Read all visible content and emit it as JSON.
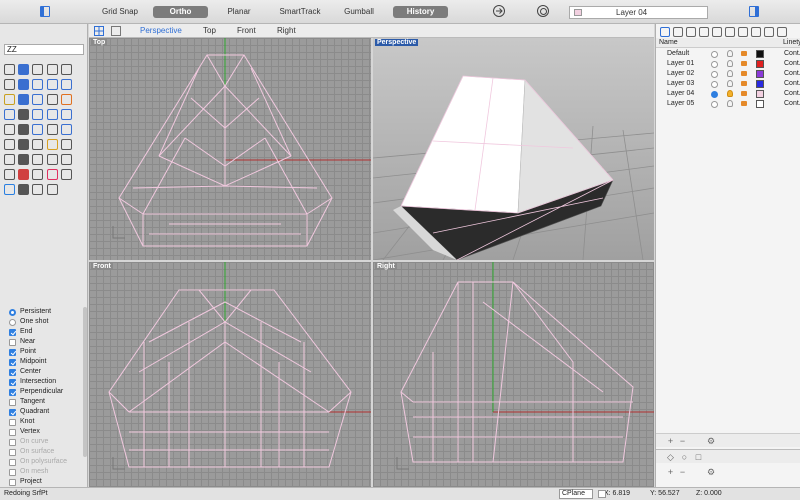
{
  "toolbar": {
    "grid_snap": "Grid Snap",
    "ortho": "Ortho",
    "planar": "Planar",
    "smarttrack": "SmartTrack",
    "gumball": "Gumball",
    "history": "History",
    "layer_current": "Layer 04"
  },
  "command_input": "ZZ",
  "viewport_tabs": [
    "Perspective",
    "Top",
    "Front",
    "Right"
  ],
  "viewports": {
    "top": "Top",
    "perspective": "Perspective",
    "front": "Front",
    "right": "Right"
  },
  "osnap": {
    "items": [
      {
        "label": "Persistent",
        "type": "radio",
        "checked": true,
        "disabled": false
      },
      {
        "label": "One shot",
        "type": "radio",
        "checked": false,
        "disabled": false
      },
      {
        "label": "End",
        "type": "check",
        "checked": true,
        "disabled": false
      },
      {
        "label": "Near",
        "type": "check",
        "checked": false,
        "disabled": false
      },
      {
        "label": "Point",
        "type": "check",
        "checked": true,
        "disabled": false
      },
      {
        "label": "Midpoint",
        "type": "check",
        "checked": true,
        "disabled": false
      },
      {
        "label": "Center",
        "type": "check",
        "checked": true,
        "disabled": false
      },
      {
        "label": "Intersection",
        "type": "check",
        "checked": true,
        "disabled": false
      },
      {
        "label": "Perpendicular",
        "type": "check",
        "checked": true,
        "disabled": false
      },
      {
        "label": "Tangent",
        "type": "check",
        "checked": false,
        "disabled": false
      },
      {
        "label": "Quadrant",
        "type": "check",
        "checked": true,
        "disabled": false
      },
      {
        "label": "Knot",
        "type": "check",
        "checked": false,
        "disabled": false
      },
      {
        "label": "Vertex",
        "type": "check",
        "checked": false,
        "disabled": false
      },
      {
        "label": "On curve",
        "type": "check",
        "checked": false,
        "disabled": true
      },
      {
        "label": "On surface",
        "type": "check",
        "checked": false,
        "disabled": true
      },
      {
        "label": "On polysurface",
        "type": "check",
        "checked": false,
        "disabled": true
      },
      {
        "label": "On mesh",
        "type": "check",
        "checked": false,
        "disabled": true
      },
      {
        "label": "Project",
        "type": "check",
        "checked": false,
        "disabled": false
      }
    ]
  },
  "layers": {
    "header_name": "Name",
    "header_linetype": "Linety",
    "rows": [
      {
        "name": "Default",
        "current": false,
        "lit": false,
        "color": "#111111",
        "linetype": "Cont."
      },
      {
        "name": "Layer 01",
        "current": false,
        "lit": false,
        "color": "#e02020",
        "linetype": "Cont."
      },
      {
        "name": "Layer 02",
        "current": false,
        "lit": false,
        "color": "#8a3ad8",
        "linetype": "Cont."
      },
      {
        "name": "Layer 03",
        "current": false,
        "lit": false,
        "color": "#2a2ae0",
        "linetype": "Cont."
      },
      {
        "name": "Layer 04",
        "current": true,
        "lit": true,
        "color": "#f2d0e0",
        "linetype": "Cont."
      },
      {
        "name": "Layer 05",
        "current": false,
        "lit": false,
        "color": "#ffffff",
        "linetype": "Cont."
      }
    ]
  },
  "status": {
    "message": "Redoing SrfPt",
    "cplane": "CPlane",
    "x": "X: 6.819",
    "y": "Y: 56.527",
    "z": "Z: 0.000"
  }
}
